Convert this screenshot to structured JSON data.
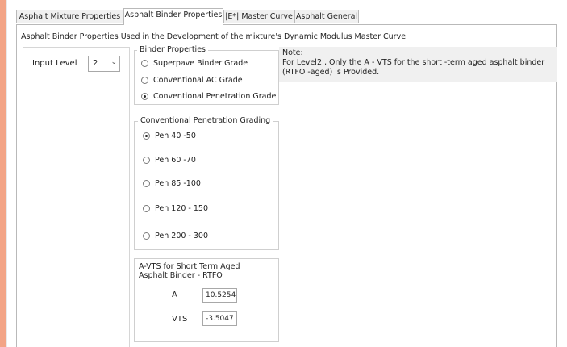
{
  "tabs": [
    {
      "label": "Asphalt Mixture Properties",
      "active": false
    },
    {
      "label": "Asphalt Binder Properties",
      "active": true
    },
    {
      "label": "|E*| Master Curve",
      "active": false
    },
    {
      "label": "Asphalt General",
      "active": false
    }
  ],
  "heading": "Asphalt Binder Properties Used in the Development of the mixture's Dynamic Modulus Master Curve",
  "input_level": {
    "label": "Input Level",
    "value": "2"
  },
  "binder_properties": {
    "title": "Binder Properties",
    "options": [
      {
        "label": "Superpave Binder Grade",
        "checked": false
      },
      {
        "label": "Conventional AC Grade",
        "checked": false
      },
      {
        "label": "Conventional Penetration Grade",
        "checked": true
      }
    ]
  },
  "note": {
    "title": "Note:",
    "text": "For Level2 , Only the A - VTS for the short -term aged asphalt binder (RTFO -aged) is Provided."
  },
  "penetration_grading": {
    "title": "Conventional Penetration Grading",
    "options": [
      {
        "label": "Pen 40 -50",
        "checked": true
      },
      {
        "label": "Pen 60 -70",
        "checked": false
      },
      {
        "label": "Pen 85 -100",
        "checked": false
      },
      {
        "label": "Pen 120 - 150",
        "checked": false
      },
      {
        "label": "Pen 200 - 300",
        "checked": false
      }
    ]
  },
  "avts": {
    "title": "A-VTS for Short Term Aged Asphalt Binder - RTFO",
    "a_label": "A",
    "a_value": "10.5254",
    "vts_label": "VTS",
    "vts_value": "-3.5047"
  },
  "colors": {
    "accent": "#f3a486",
    "note_bg": "#f0f0f0"
  }
}
